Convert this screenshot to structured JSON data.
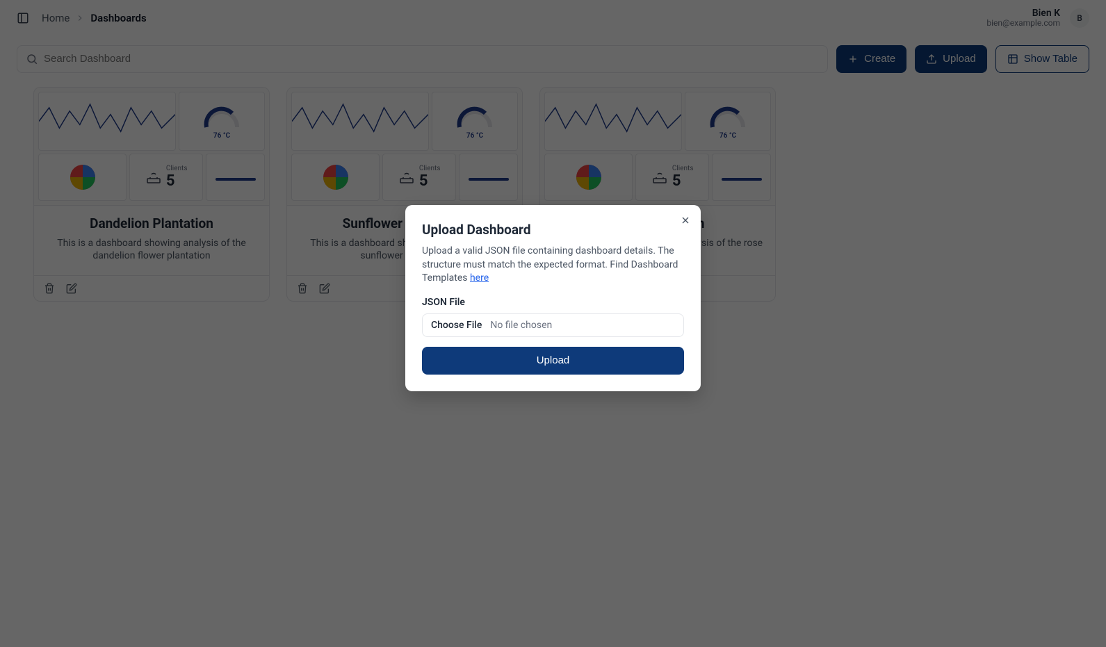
{
  "breadcrumb": {
    "home": "Home",
    "current": "Dashboards"
  },
  "user": {
    "name": "Bien K",
    "email": "bien@example.com",
    "initial": "B"
  },
  "search": {
    "placeholder": "Search Dashboard"
  },
  "buttons": {
    "create": "Create",
    "upload": "Upload",
    "show_table": "Show Table"
  },
  "preview": {
    "gauge_label": "76 °C",
    "clients_label": "Clients",
    "clients_value": "5"
  },
  "cards": [
    {
      "title": "Dandelion Plantation",
      "desc": "This is a dashboard showing analysis of the dandelion flower plantation"
    },
    {
      "title": "Sunflower Plantation",
      "desc": "This is a dashboard showing analysis of the sunflower plantation"
    },
    {
      "title": "Rose Plantation",
      "desc": "This is a dashboard showing analysis of the rose plantation"
    }
  ],
  "modal": {
    "title": "Upload Dashboard",
    "desc_pre": "Upload a valid JSON file containing dashboard details. The structure must match the expected format. Find Dashboard Templates ",
    "desc_link": "here",
    "field_label": "JSON File",
    "choose_file": "Choose File",
    "no_file": "No file chosen",
    "upload": "Upload"
  }
}
